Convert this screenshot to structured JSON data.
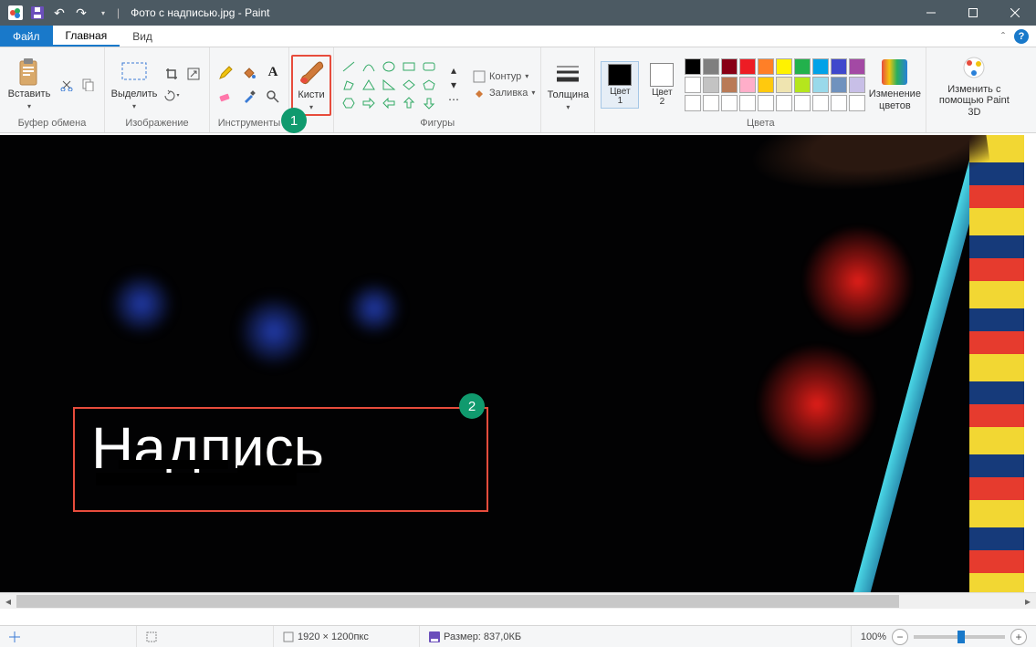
{
  "title": "Фото с надписью.jpg - Paint",
  "tabs": {
    "file": "Файл",
    "home": "Главная",
    "view": "Вид"
  },
  "ribbon": {
    "clipboard": {
      "paste": "Вставить",
      "label": "Буфер обмена"
    },
    "image": {
      "select": "Выделить",
      "label": "Изображение"
    },
    "tools": {
      "label": "Инструменты"
    },
    "brushes": {
      "label": "Кисти"
    },
    "shapes": {
      "outline": "Контур",
      "fill": "Заливка",
      "label": "Фигуры"
    },
    "size": {
      "label": "Толщина"
    },
    "colors": {
      "c1": "Цвет\n1",
      "c2": "Цвет\n2",
      "edit": "Изменение\nцветов",
      "label": "Цвета"
    },
    "paint3d": {
      "label": "Изменить с\nпомощью Paint 3D"
    }
  },
  "palette_colors": [
    "#000000",
    "#7f7f7f",
    "#880015",
    "#ed1c24",
    "#ff7f27",
    "#fff200",
    "#22b14c",
    "#00a2e8",
    "#3f48cc",
    "#a349a4",
    "#ffffff",
    "#c3c3c3",
    "#b97a57",
    "#ffaec9",
    "#ffc90e",
    "#efe4b0",
    "#b5e61d",
    "#99d9ea",
    "#7092be",
    "#c8bfe7",
    "#ffffff",
    "#ffffff",
    "#ffffff",
    "#ffffff",
    "#ffffff",
    "#ffffff",
    "#ffffff",
    "#ffffff",
    "#ffffff",
    "#ffffff"
  ],
  "color1": "#000000",
  "color2": "#ffffff",
  "canvas": {
    "caption": "Надпись"
  },
  "markers": {
    "m1": "1",
    "m2": "2"
  },
  "status": {
    "dimensions": "1920 × 1200пкс",
    "filesize": "Размер: 837,0КБ",
    "zoom": "100%"
  }
}
